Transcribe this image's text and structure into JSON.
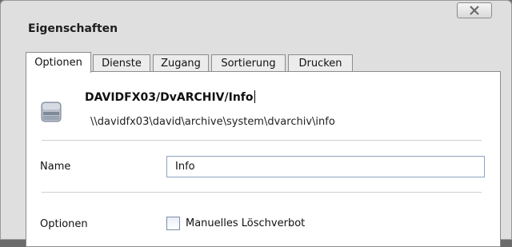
{
  "dialog": {
    "title": "Eigenschaften",
    "close_icon": "close-x-icon"
  },
  "tabs": [
    {
      "label": "Optionen",
      "active": true
    },
    {
      "label": "Dienste",
      "active": false
    },
    {
      "label": "Zugang",
      "active": false
    },
    {
      "label": "Sortierung",
      "active": false
    },
    {
      "label": "Drucken",
      "active": false
    }
  ],
  "object": {
    "icon": "archive-drawer-icon",
    "title": "DAVIDFX03/DvARCHIV/Info",
    "path": "\\\\davidfx03\\david\\archive\\system\\dvarchiv\\info"
  },
  "fields": {
    "name_label": "Name",
    "name_value": "Info",
    "options_label": "Optionen",
    "manual_delete_lock_label": "Manuelles Löschverbot",
    "manual_delete_lock_checked": false
  }
}
